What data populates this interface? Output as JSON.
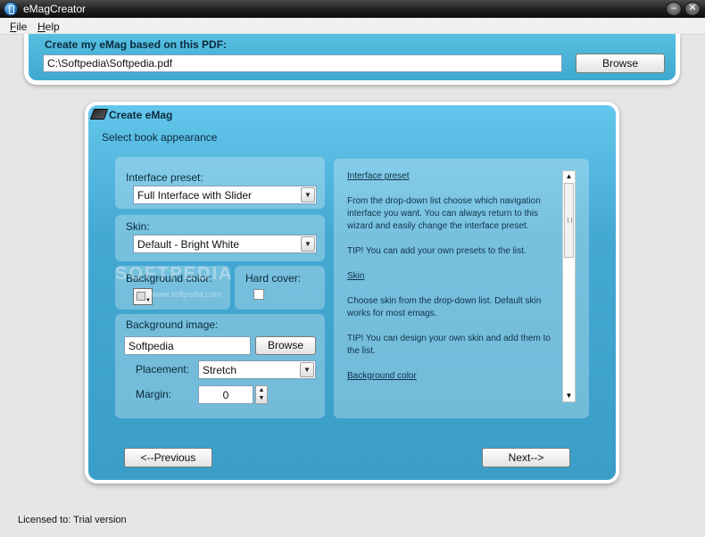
{
  "window": {
    "title": "eMagCreator"
  },
  "menu": {
    "file": "File",
    "help": "Help"
  },
  "pdf_section": {
    "label": "Create my eMag based on this PDF:",
    "path": "C:\\Softpedia\\Softpedia.pdf",
    "browse": "Browse"
  },
  "wizard": {
    "title": "Create eMag",
    "subtitle": "Select book appearance",
    "interface_preset": {
      "label": "Interface preset:",
      "value": "Full Interface with Slider"
    },
    "skin": {
      "label": "Skin:",
      "value": "Default - Bright White"
    },
    "background_color": {
      "label": "Background color:"
    },
    "hard_cover": {
      "label": "Hard cover:",
      "checked": false
    },
    "background_image": {
      "label": "Background image:",
      "value": "Softpedia",
      "browse": "Browse",
      "placement_label": "Placement:",
      "placement_value": "Stretch",
      "margin_label": "Margin:",
      "margin_value": "0"
    },
    "help": {
      "interface_preset_link": "Interface preset",
      "interface_preset_text": "From the drop-down list choose which navigation interface you want. You can always return to this wizard and easily change the interface preset.",
      "interface_preset_tip": "TIP! You can add your own presets to the list.",
      "skin_link": "Skin",
      "skin_text": "Choose skin from the drop-down list. Default skin works for most emags.",
      "skin_tip": "TIP! You can design your own skin and add them to the list.",
      "background_color_link": "Background color"
    },
    "previous": "<--Previous",
    "next": "Next-->"
  },
  "watermark": {
    "text": "SOFTPEDIA",
    "url": "www.softpedia.com"
  },
  "status": {
    "license": "Licensed to: Trial version"
  }
}
